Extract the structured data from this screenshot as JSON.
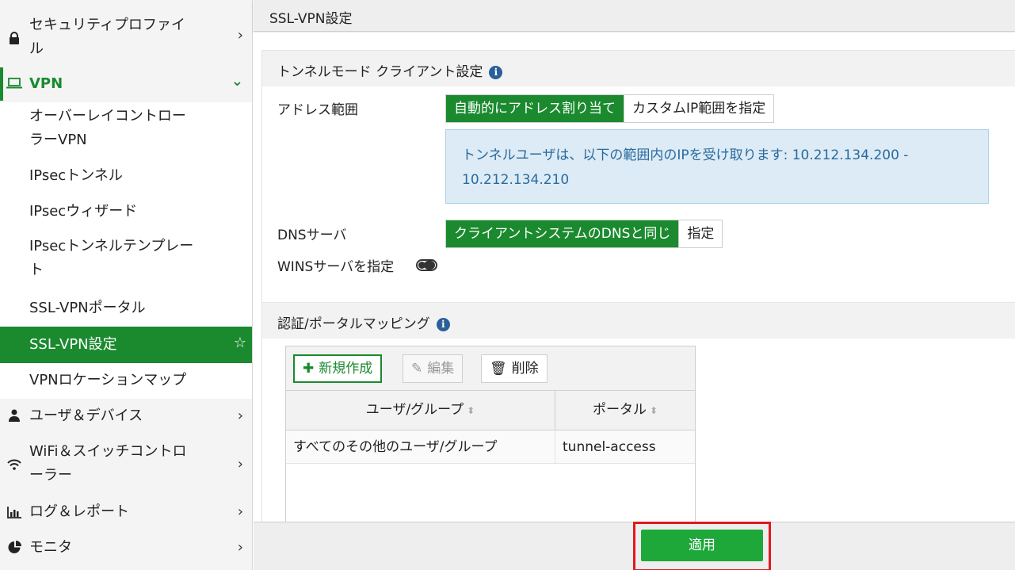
{
  "sidebar": {
    "items_top": [
      {
        "label": "セキュリティプロファイ\nル",
        "icon": "lock-icon",
        "chevron": "›"
      }
    ],
    "vpn": {
      "label": "VPN",
      "icon": "laptop-icon",
      "chevron": "⌄"
    },
    "vpn_subitems": [
      {
        "label": "オーバーレイコントロー\nラーVPN"
      },
      {
        "label": "IPsecトンネル"
      },
      {
        "label": "IPsecウィザード"
      },
      {
        "label": "IPsecトンネルテンプレー\nト"
      },
      {
        "label": "SSL-VPNポータル"
      },
      {
        "label": "SSL-VPN設定"
      },
      {
        "label": "VPNロケーションマップ"
      }
    ],
    "items_bottom": [
      {
        "label": "ユーザ＆デバイス",
        "icon": "user-icon",
        "chevron": "›"
      },
      {
        "label": "WiFi＆スイッチコントロ\nーラー",
        "icon": "wifi-icon",
        "chevron": "›"
      },
      {
        "label": "ログ＆レポート",
        "icon": "bar-chart-icon",
        "chevron": "›"
      },
      {
        "label": "モニタ",
        "icon": "pie-chart-icon",
        "chevron": "›"
      }
    ],
    "star": "☆"
  },
  "header": {
    "title": "SSL-VPN設定"
  },
  "tunnel_section": {
    "title": "トンネルモード クライアント設定",
    "info": "i",
    "address_label": "アドレス範囲",
    "address_options": [
      "自動的にアドレス割り当て",
      "カスタムIP範囲を指定"
    ],
    "info_text": "トンネルユーザは、以下の範囲内のIPを受け取ります: 10.212.134.200 - 10.212.134.210",
    "dns_label": "DNSサーバ",
    "dns_options": [
      "クライアントシステムのDNSと同じ",
      "指定"
    ],
    "wins_label": "WINSサーバを指定"
  },
  "auth_section": {
    "title": "認証/ポータルマッピング",
    "info": "i",
    "create_label": "新規作成",
    "edit_label": "編集",
    "delete_label": "削除",
    "columns": [
      "ユーザ/グループ",
      "ポータル"
    ],
    "sort_glyph": "⬍",
    "rows": [
      {
        "group": "すべてのその他のユーザ/グループ",
        "portal": "tunnel-access"
      }
    ]
  },
  "footer": {
    "apply_label": "適用"
  },
  "colors": {
    "accent": "#1b8a2f",
    "apply": "#1ea83a",
    "highlight": "#e0191c",
    "info_bg": "#dcebf5"
  }
}
